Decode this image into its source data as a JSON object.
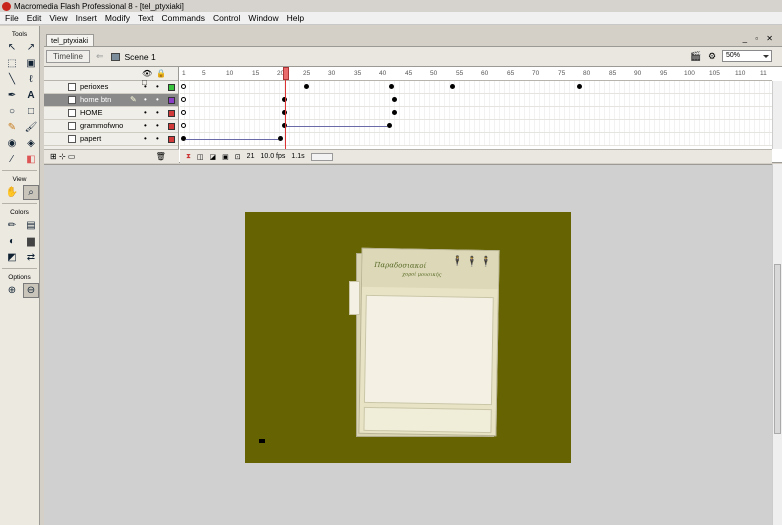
{
  "window": {
    "title": "Macromedia Flash Professional 8 - [tel_ptyxiaki]"
  },
  "menu": [
    "File",
    "Edit",
    "View",
    "Insert",
    "Modify",
    "Text",
    "Commands",
    "Control",
    "Window",
    "Help"
  ],
  "tools": {
    "title": "Tools",
    "view_title": "View",
    "colors_title": "Colors",
    "options_title": "Options"
  },
  "document": {
    "tab": "tel_ptyxiaki",
    "timeline_button": "Timeline",
    "scene": "Scene 1",
    "zoom": "50%"
  },
  "timeline": {
    "ruler": [
      "1",
      "5",
      "10",
      "15",
      "20",
      "25",
      "30",
      "35",
      "40",
      "45",
      "50",
      "55",
      "60",
      "65",
      "70",
      "75",
      "80",
      "85",
      "90",
      "95",
      "100",
      "105",
      "110",
      "11"
    ],
    "layers": [
      {
        "name": "perioxes",
        "color": "#39c43e"
      },
      {
        "name": "home btn",
        "color": "#8b3fc6",
        "selected": true
      },
      {
        "name": "HOME",
        "color": "#d33a3a"
      },
      {
        "name": "grammofwno",
        "color": "#d33a3a"
      },
      {
        "name": "papert",
        "color": "#d33a3a"
      }
    ],
    "current_frame": "21",
    "fps": "10.0 fps",
    "elapsed": "1.1s"
  },
  "stage": {
    "background": "#666402",
    "paper_title": "Παραδοσιακοί",
    "paper_subtitle": "χοροί μουσικής"
  }
}
